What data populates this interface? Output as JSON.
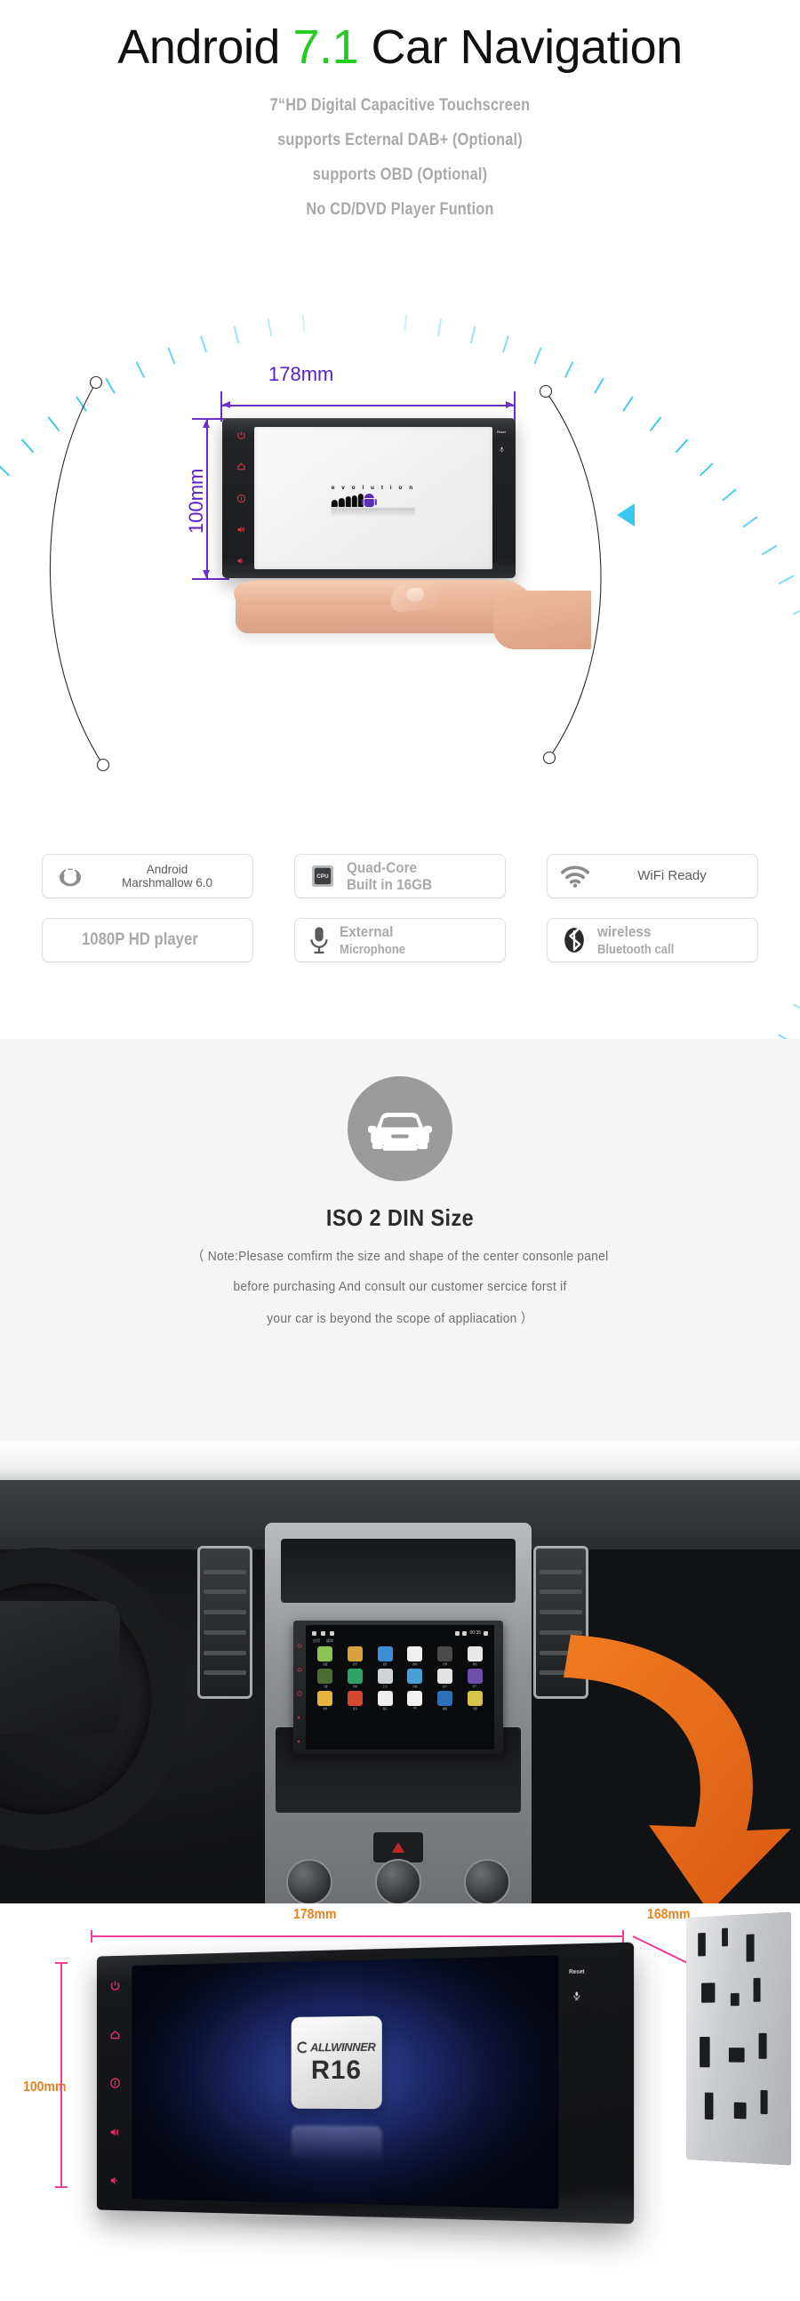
{
  "hero": {
    "title_pre": "Android ",
    "title_version": "7.1",
    "title_post": " Car Navigation",
    "subtitles": [
      "7“HD Digital Capacitive Touchscreen",
      "supports Ecternal  DAB+ (Optional)",
      "supports OBD   (Optional)",
      "No CD/DVD Player Funtion"
    ],
    "dimensions": {
      "width_label": "178mm",
      "height_label": "100mm"
    },
    "device_screen": {
      "evolution_word": "e v o l u t i o n"
    },
    "side_buttons": [
      "power-icon",
      "home-icon",
      "info-icon",
      "volume-up-icon",
      "volume-down-icon"
    ],
    "right_labels": {
      "reset": "Reset",
      "mic": "mic-icon"
    }
  },
  "badges": {
    "row1": [
      {
        "icon": "android-marshmallow-icon",
        "line1": "Android",
        "line2": "Marshmallow 6.0",
        "style": "thin"
      },
      {
        "icon": "cpu-chip-icon",
        "line1": "Quad-Core",
        "line2": "Built in 16GB",
        "style": "bold"
      },
      {
        "icon": "wifi-icon",
        "line1": "WiFi Ready",
        "line2": "",
        "style": "thin"
      }
    ],
    "row2": [
      {
        "icon": "",
        "line1": "1080P HD player",
        "line2": "",
        "style": "bold"
      },
      {
        "icon": "microphone-icon",
        "line1": "External",
        "line2": "Microphone",
        "style": "bold"
      },
      {
        "icon": "bluetooth-icon",
        "line1": "wireless",
        "line2": "Bluetooth call",
        "style": "bold"
      }
    ]
  },
  "iso": {
    "icon": "car-front-icon",
    "title": "ISO 2 DIN Size",
    "note_lines": [
      "（ Note:Plesase comfirm the size and shape of the center consonle panel",
      "before purchasing And consult our customer sercice forst if",
      "your car is beyond the scope of appliacation ）"
    ]
  },
  "dash": {
    "status_bar": {
      "clock": "00:35"
    },
    "tabs": [
      "应用",
      "媒体"
    ],
    "apps": [
      {
        "label": "设置",
        "color": "#8fc254"
      },
      {
        "label": "音乐",
        "color": "#d9a13b"
      },
      {
        "label": "蓝牙",
        "color": "#3f8fd6"
      },
      {
        "label": "搜狗",
        "color": "#f0f0f0"
      },
      {
        "label": "计算",
        "color": "#4a4a4a"
      },
      {
        "label": "浏览",
        "color": "#e8e8e8"
      },
      {
        "label": "下载",
        "color": "#4d6b34"
      },
      {
        "label": "导航",
        "color": "#2ea36b"
      },
      {
        "label": "工具",
        "color": "#cfd4d8"
      },
      {
        "label": "音效",
        "color": "#4a9fd4"
      },
      {
        "label": "铃声",
        "color": "#e3e3e3"
      },
      {
        "label": "天气",
        "color": "#6d4ea8"
      },
      {
        "label": "文件",
        "color": "#e5b33e"
      },
      {
        "label": "录音",
        "color": "#d8472f"
      },
      {
        "label": "商店",
        "color": "#efefef"
      },
      {
        "label": "QQ",
        "color": "#f2f2f2"
      },
      {
        "label": "视频",
        "color": "#2f6fb5"
      },
      {
        "label": "计划",
        "color": "#d9c44a"
      }
    ]
  },
  "product": {
    "dimensions": {
      "width_label": "178mm",
      "depth_label": "168mm",
      "height_label": "100mm"
    },
    "chip": {
      "brand": "ALLWINNER",
      "model": "R16"
    },
    "right_labels": {
      "reset": "Reset",
      "mic": "mic-icon"
    },
    "side_buttons": [
      "power-icon",
      "home-icon",
      "info-icon",
      "volume-up-icon",
      "volume-down-icon"
    ]
  },
  "colors": {
    "accent_green": "#22cc22",
    "subtitle_gray": "#a9a9a9",
    "dimension_purple": "#5b21c9",
    "dimension_pink": "#ef3f96",
    "dimension_orange": "#e8801c",
    "tick_cyan": "#3cc8f0",
    "iso_bg": "#f5f5f5"
  }
}
